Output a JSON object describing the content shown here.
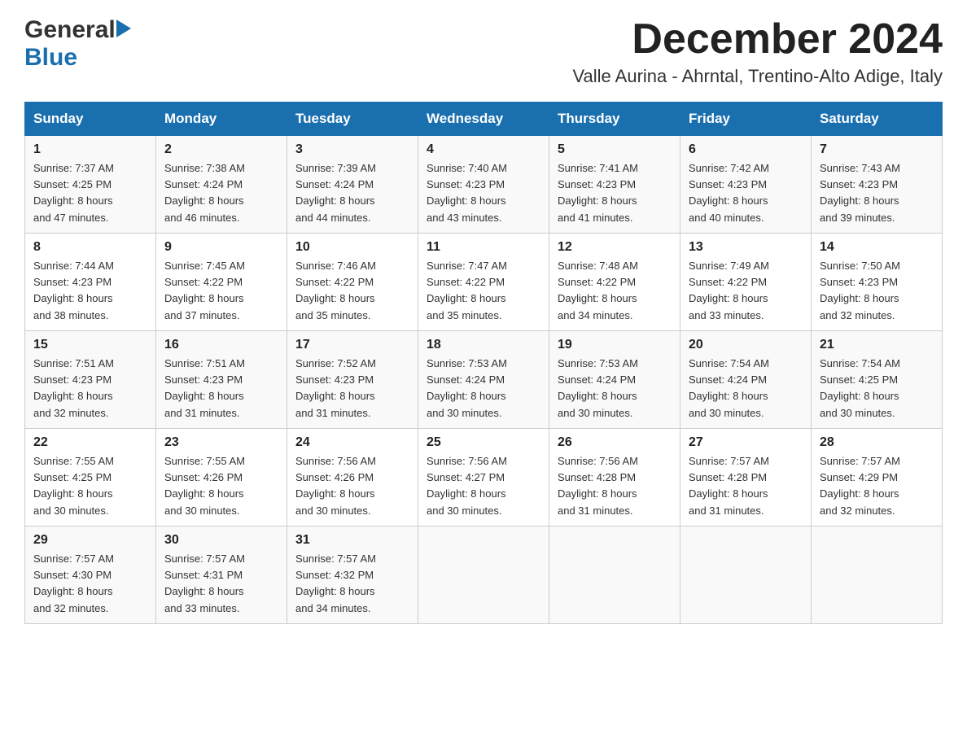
{
  "header": {
    "logo_general": "General",
    "logo_blue": "Blue",
    "month_title": "December 2024",
    "location": "Valle Aurina - Ahrntal, Trentino-Alto Adige, Italy"
  },
  "days_of_week": [
    "Sunday",
    "Monday",
    "Tuesday",
    "Wednesday",
    "Thursday",
    "Friday",
    "Saturday"
  ],
  "weeks": [
    [
      {
        "day": "1",
        "sunrise": "7:37 AM",
        "sunset": "4:25 PM",
        "daylight": "8 hours and 47 minutes."
      },
      {
        "day": "2",
        "sunrise": "7:38 AM",
        "sunset": "4:24 PM",
        "daylight": "8 hours and 46 minutes."
      },
      {
        "day": "3",
        "sunrise": "7:39 AM",
        "sunset": "4:24 PM",
        "daylight": "8 hours and 44 minutes."
      },
      {
        "day": "4",
        "sunrise": "7:40 AM",
        "sunset": "4:23 PM",
        "daylight": "8 hours and 43 minutes."
      },
      {
        "day": "5",
        "sunrise": "7:41 AM",
        "sunset": "4:23 PM",
        "daylight": "8 hours and 41 minutes."
      },
      {
        "day": "6",
        "sunrise": "7:42 AM",
        "sunset": "4:23 PM",
        "daylight": "8 hours and 40 minutes."
      },
      {
        "day": "7",
        "sunrise": "7:43 AM",
        "sunset": "4:23 PM",
        "daylight": "8 hours and 39 minutes."
      }
    ],
    [
      {
        "day": "8",
        "sunrise": "7:44 AM",
        "sunset": "4:23 PM",
        "daylight": "8 hours and 38 minutes."
      },
      {
        "day": "9",
        "sunrise": "7:45 AM",
        "sunset": "4:22 PM",
        "daylight": "8 hours and 37 minutes."
      },
      {
        "day": "10",
        "sunrise": "7:46 AM",
        "sunset": "4:22 PM",
        "daylight": "8 hours and 35 minutes."
      },
      {
        "day": "11",
        "sunrise": "7:47 AM",
        "sunset": "4:22 PM",
        "daylight": "8 hours and 35 minutes."
      },
      {
        "day": "12",
        "sunrise": "7:48 AM",
        "sunset": "4:22 PM",
        "daylight": "8 hours and 34 minutes."
      },
      {
        "day": "13",
        "sunrise": "7:49 AM",
        "sunset": "4:22 PM",
        "daylight": "8 hours and 33 minutes."
      },
      {
        "day": "14",
        "sunrise": "7:50 AM",
        "sunset": "4:23 PM",
        "daylight": "8 hours and 32 minutes."
      }
    ],
    [
      {
        "day": "15",
        "sunrise": "7:51 AM",
        "sunset": "4:23 PM",
        "daylight": "8 hours and 32 minutes."
      },
      {
        "day": "16",
        "sunrise": "7:51 AM",
        "sunset": "4:23 PM",
        "daylight": "8 hours and 31 minutes."
      },
      {
        "day": "17",
        "sunrise": "7:52 AM",
        "sunset": "4:23 PM",
        "daylight": "8 hours and 31 minutes."
      },
      {
        "day": "18",
        "sunrise": "7:53 AM",
        "sunset": "4:24 PM",
        "daylight": "8 hours and 30 minutes."
      },
      {
        "day": "19",
        "sunrise": "7:53 AM",
        "sunset": "4:24 PM",
        "daylight": "8 hours and 30 minutes."
      },
      {
        "day": "20",
        "sunrise": "7:54 AM",
        "sunset": "4:24 PM",
        "daylight": "8 hours and 30 minutes."
      },
      {
        "day": "21",
        "sunrise": "7:54 AM",
        "sunset": "4:25 PM",
        "daylight": "8 hours and 30 minutes."
      }
    ],
    [
      {
        "day": "22",
        "sunrise": "7:55 AM",
        "sunset": "4:25 PM",
        "daylight": "8 hours and 30 minutes."
      },
      {
        "day": "23",
        "sunrise": "7:55 AM",
        "sunset": "4:26 PM",
        "daylight": "8 hours and 30 minutes."
      },
      {
        "day": "24",
        "sunrise": "7:56 AM",
        "sunset": "4:26 PM",
        "daylight": "8 hours and 30 minutes."
      },
      {
        "day": "25",
        "sunrise": "7:56 AM",
        "sunset": "4:27 PM",
        "daylight": "8 hours and 30 minutes."
      },
      {
        "day": "26",
        "sunrise": "7:56 AM",
        "sunset": "4:28 PM",
        "daylight": "8 hours and 31 minutes."
      },
      {
        "day": "27",
        "sunrise": "7:57 AM",
        "sunset": "4:28 PM",
        "daylight": "8 hours and 31 minutes."
      },
      {
        "day": "28",
        "sunrise": "7:57 AM",
        "sunset": "4:29 PM",
        "daylight": "8 hours and 32 minutes."
      }
    ],
    [
      {
        "day": "29",
        "sunrise": "7:57 AM",
        "sunset": "4:30 PM",
        "daylight": "8 hours and 32 minutes."
      },
      {
        "day": "30",
        "sunrise": "7:57 AM",
        "sunset": "4:31 PM",
        "daylight": "8 hours and 33 minutes."
      },
      {
        "day": "31",
        "sunrise": "7:57 AM",
        "sunset": "4:32 PM",
        "daylight": "8 hours and 34 minutes."
      },
      null,
      null,
      null,
      null
    ]
  ],
  "labels": {
    "sunrise": "Sunrise:",
    "sunset": "Sunset:",
    "daylight": "Daylight:"
  },
  "colors": {
    "header_bg": "#1a6faf",
    "header_text": "#ffffff",
    "logo_blue": "#1a6faf",
    "logo_general": "#333333"
  }
}
